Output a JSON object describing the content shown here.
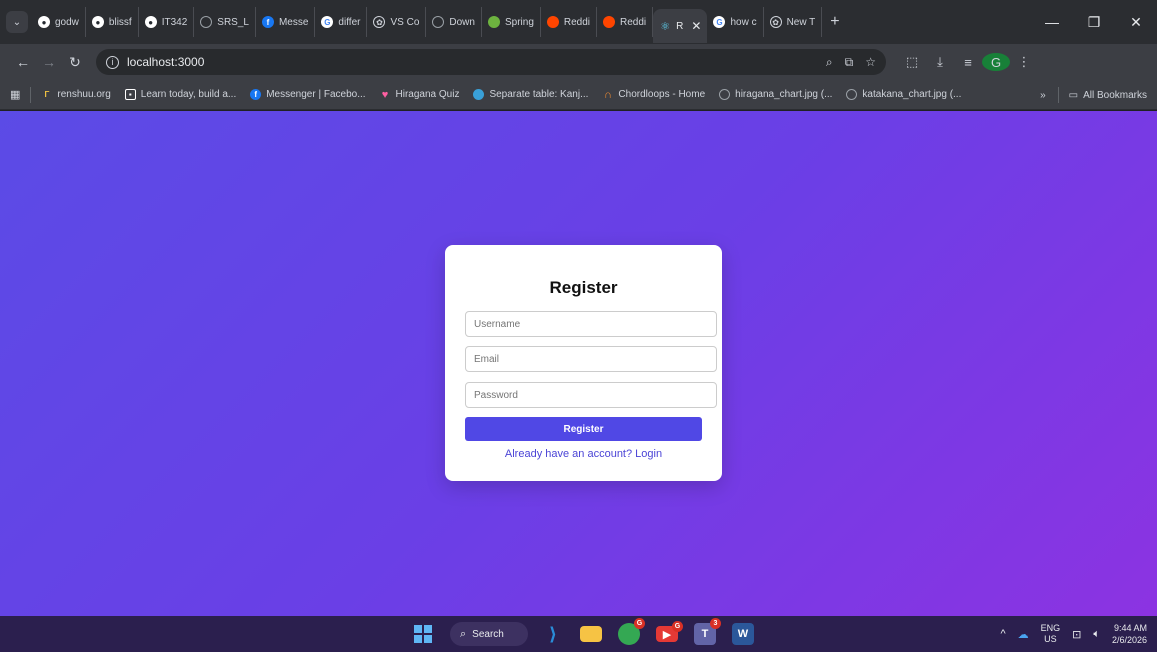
{
  "browser": {
    "tab_menu_icon": "chevron-down-icon",
    "tabs": [
      {
        "title": "godw",
        "icon": "github-icon",
        "icon_color": "#ffffff"
      },
      {
        "title": "blissf",
        "icon": "github-icon",
        "icon_color": "#ffffff"
      },
      {
        "title": "IT342",
        "icon": "github-icon",
        "icon_color": "#ffffff"
      },
      {
        "title": "SRS_L",
        "icon": "globe-icon",
        "icon_color": "#9aa0a6"
      },
      {
        "title": "Messe",
        "icon": "facebook-icon",
        "icon_color": "#1877f2"
      },
      {
        "title": "differ",
        "icon": "google-icon",
        "icon_color": "#4285f4"
      },
      {
        "title": "VS Co",
        "icon": "openai-icon",
        "icon_color": "#cfd3da"
      },
      {
        "title": "Down",
        "icon": "globe-icon",
        "icon_color": "#9aa0a6"
      },
      {
        "title": "Spring",
        "icon": "spring-icon",
        "icon_color": "#6db33f"
      },
      {
        "title": "Reddi",
        "icon": "reddit-icon",
        "icon_color": "#ff4500"
      },
      {
        "title": "Reddi",
        "icon": "reddit-icon",
        "icon_color": "#ff4500"
      },
      {
        "title": "R",
        "icon": "react-icon",
        "icon_color": "#61dafb",
        "active": true
      },
      {
        "title": "how c",
        "icon": "google-icon",
        "icon_color": "#4285f4"
      },
      {
        "title": "New T",
        "icon": "openai-icon",
        "icon_color": "#cfd3da"
      }
    ],
    "new_tab_label": "+",
    "address": {
      "url": "localhost:3000"
    },
    "bookmarks": [
      {
        "label": "renshuu.org",
        "icon": "renshuu-icon",
        "icon_color": "#f4c542"
      },
      {
        "label": "Learn today, build a...",
        "icon": "app-icon",
        "icon_color": "#ffffff"
      },
      {
        "label": "Messenger | Facebo...",
        "icon": "facebook-icon",
        "icon_color": "#1877f2"
      },
      {
        "label": "Hiragana Quiz",
        "icon": "heart-icon",
        "icon_color": "#ff5fa2"
      },
      {
        "label": "Separate table: Kanj...",
        "icon": "globe-icon",
        "icon_color": "#39a0d8"
      },
      {
        "label": "Chordloops - Home",
        "icon": "headphones-icon",
        "icon_color": "#f28b30"
      },
      {
        "label": "hiragana_chart.jpg (...",
        "icon": "globe-icon",
        "icon_color": "#9aa0a6"
      },
      {
        "label": "katakana_chart.jpg (...",
        "icon": "globe-icon",
        "icon_color": "#9aa0a6"
      }
    ],
    "bookmarks_more": "»",
    "all_bookmarks_label": "All Bookmarks",
    "profile_initial": "G"
  },
  "page": {
    "gradient_start": "#5b4be6",
    "gradient_end": "#8c33e2",
    "register_form": {
      "title": "Register",
      "username_placeholder": "Username",
      "email_placeholder": "Email",
      "password_placeholder": "Password",
      "submit_label": "Register",
      "login_link": "Already have an account? Login",
      "button_color": "#5048e5"
    }
  },
  "taskbar": {
    "search_label": "Search",
    "apps": [
      {
        "name": "vscode",
        "icon": "vscode-icon",
        "color": "#2a8cd8"
      },
      {
        "name": "file-explorer",
        "icon": "folder-icon",
        "color": "#f6c344"
      },
      {
        "name": "chrome",
        "icon": "chrome-icon",
        "color": "#34a853",
        "badge": "G"
      },
      {
        "name": "youtube",
        "icon": "youtube-icon",
        "color": "#e53935",
        "badge": "G"
      },
      {
        "name": "teams",
        "icon": "teams-icon",
        "color": "#6264a7",
        "badge": "3"
      },
      {
        "name": "word",
        "icon": "word-icon",
        "color": "#2b579a"
      }
    ],
    "lang_top": "ENG",
    "lang_bottom": "US",
    "time": "9:44 AM",
    "date": "2/6/2026"
  }
}
